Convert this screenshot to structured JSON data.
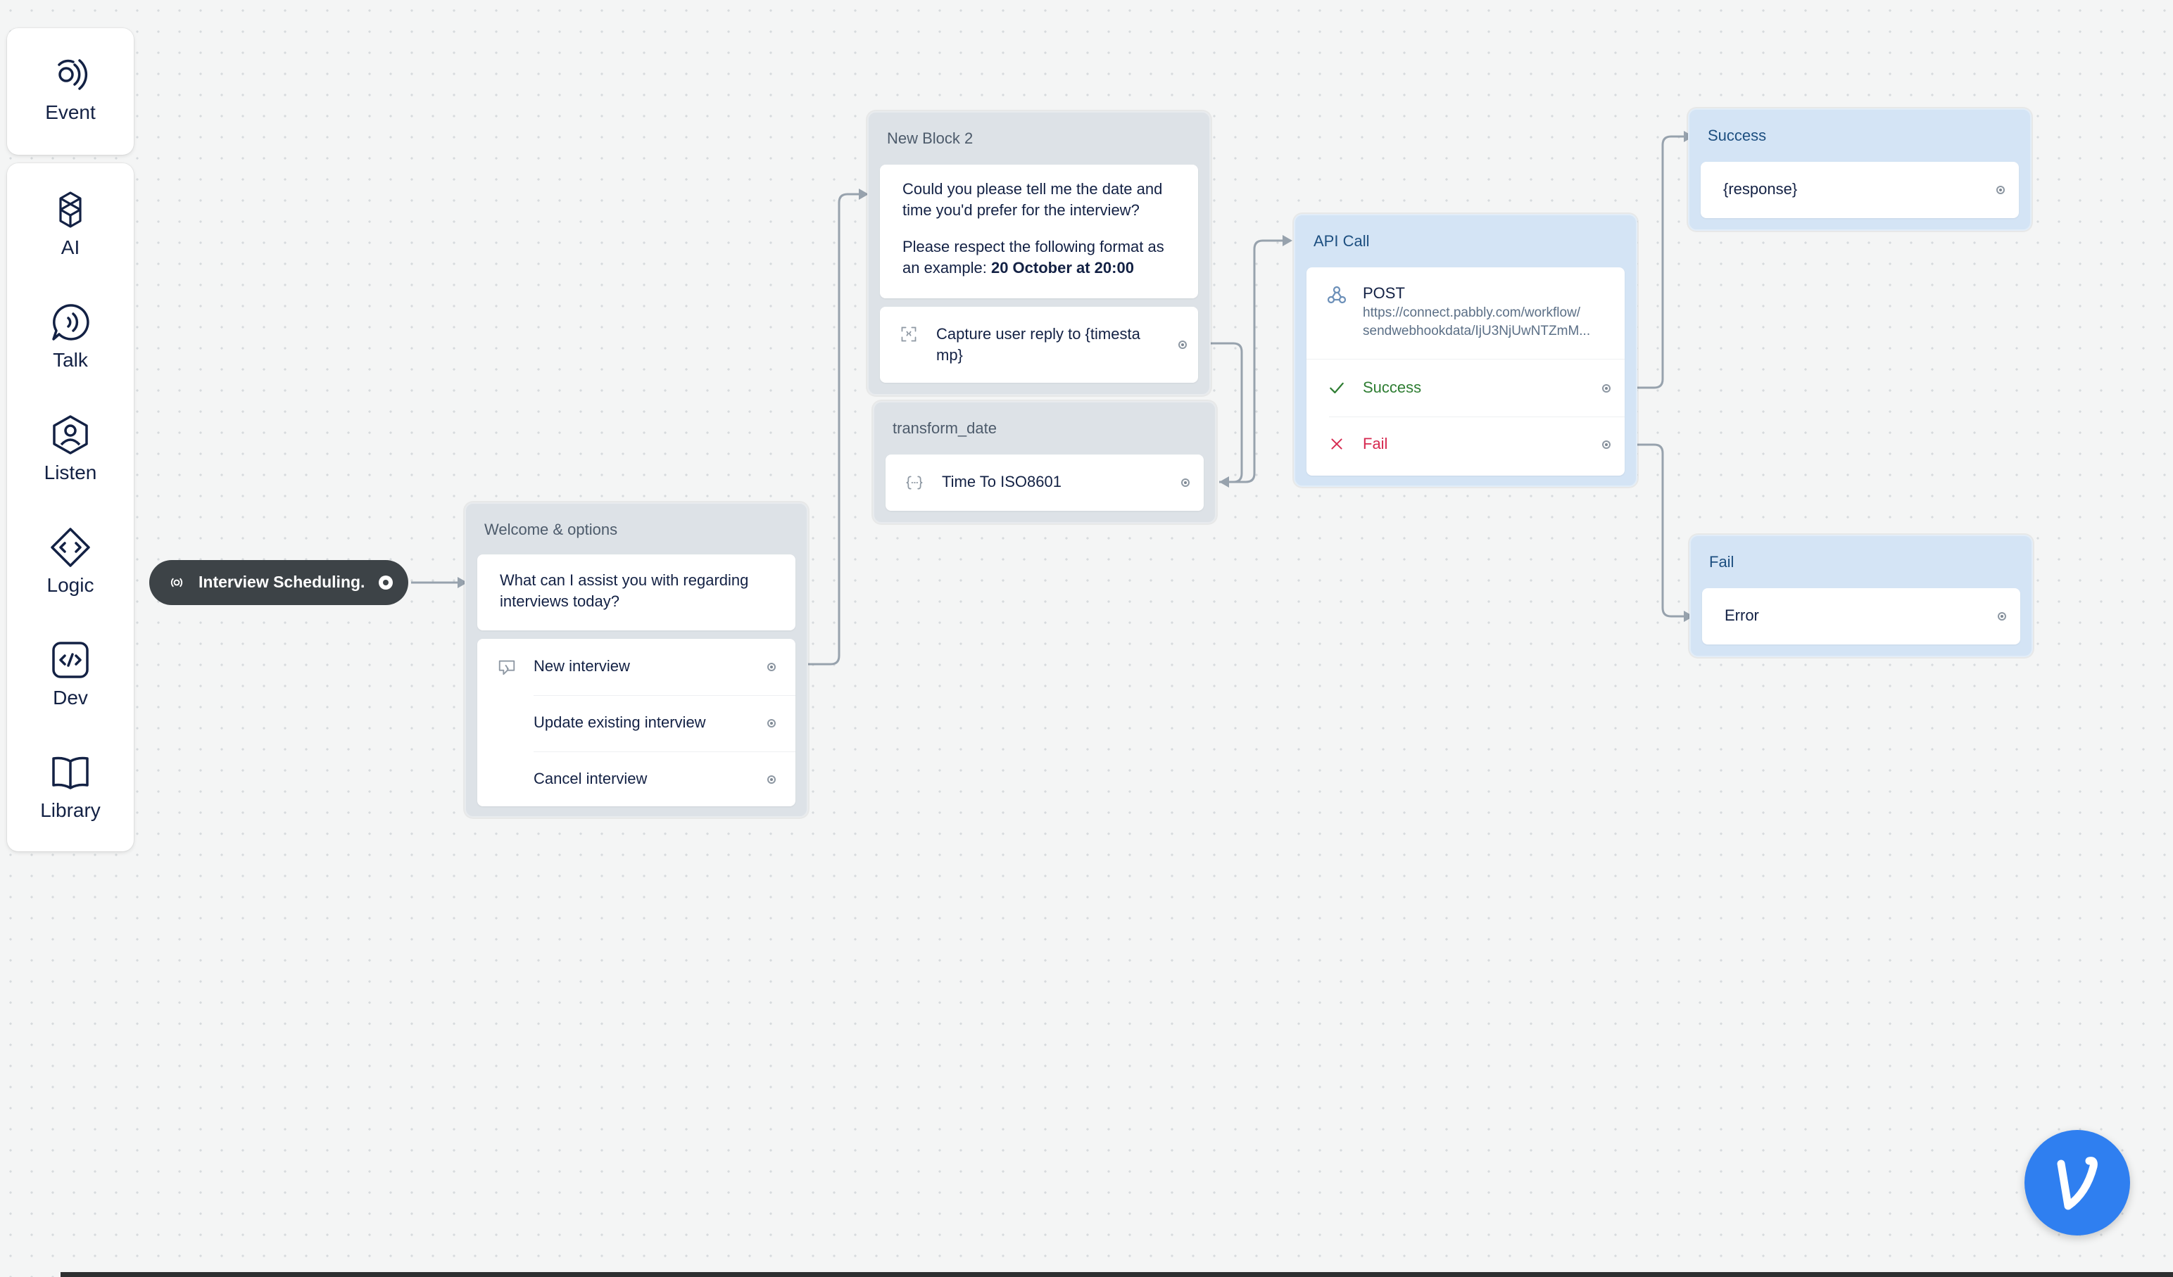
{
  "toolbar": {
    "event": "Event",
    "ai": "AI",
    "talk": "Talk",
    "listen": "Listen",
    "logic": "Logic",
    "dev": "Dev",
    "library": "Library"
  },
  "start_node": {
    "label": "Interview Scheduling."
  },
  "welcome": {
    "title": "Welcome & options",
    "message_line1": "What can I assist you with regarding",
    "message_line2": "interviews today?",
    "choices": [
      "New interview",
      "Update existing interview",
      "Cancel interview"
    ]
  },
  "new_block": {
    "title": "New Block 2",
    "line1": "Could you please tell me the date and",
    "line2": "time you'd prefer for the interview?",
    "line3": "Please respect the following format as",
    "line4_prefix": "an example: ",
    "line4_bold": "20 October at 20:00",
    "capture_line1": "Capture user reply to {timesta",
    "capture_line2": "mp}"
  },
  "transform": {
    "title": "transform_date",
    "function": "Time To ISO8601"
  },
  "api": {
    "title": "API Call",
    "method": "POST",
    "url_line1": "https://connect.pabbly.com/workflow/",
    "url_line2": "sendwebhookdata/IjU3NjUwNTZmM...",
    "success": "Success",
    "fail": "Fail"
  },
  "success_block": {
    "title": "Success",
    "text": "{response}"
  },
  "fail_block": {
    "title": "Fail",
    "text": "Error"
  },
  "colors": {
    "success_green": "#2e7d32",
    "fail_red": "#d62950",
    "wire": "#97a2ad",
    "start_node_bg": "#3d4347",
    "fab_blue": "#2f7ff0"
  },
  "icons": {
    "event": "event-icon",
    "ai": "ai-icon",
    "talk": "talk-icon",
    "listen": "listen-icon",
    "logic": "logic-icon",
    "dev": "dev-icon",
    "library": "library-icon"
  }
}
